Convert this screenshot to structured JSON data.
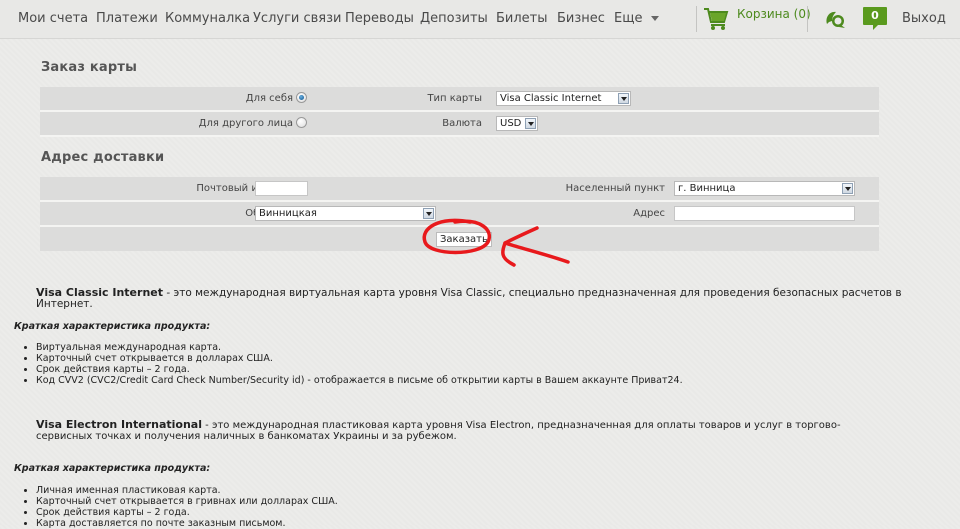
{
  "nav": {
    "items": [
      "Мои счета",
      "Платежи",
      "Коммуналка",
      "Услуги связи",
      "Переводы",
      "Депозиты",
      "Билеты",
      "Бизнес",
      "Еще"
    ],
    "cart_label": "Корзина (0)",
    "messages_count": "0",
    "logout": "Выход",
    "accent_color": "#5a9a1e"
  },
  "order": {
    "title": "Заказ карты",
    "for_self_label": "Для себя",
    "for_other_label": "Для другого лица",
    "recipient_selected": "Для себя",
    "card_type_label": "Тип карты",
    "card_type_value": "Visa Classic Internet",
    "currency_label": "Валюта",
    "currency_value": "USD"
  },
  "delivery": {
    "title": "Адрес доставки",
    "postal_label": "Почтовый индекс",
    "postal_value": "",
    "region_label": "Область",
    "region_value": "Винницкая",
    "city_label": "Населенный пункт",
    "city_value": "г. Винница",
    "address_label": "Адрес",
    "address_value": "",
    "submit_label": "Заказать"
  },
  "products": [
    {
      "name": "Visa Classic Internet",
      "description": " - это международная виртуальная карта уровня Visa Classic, специально предназначенная для проведения безопасных расчетов в Интернет.",
      "features_title": "Краткая характеристика продукта:",
      "features": [
        "Виртуальная международная карта.",
        "Карточный счет открывается в долларах США.",
        "Срок действия карты – 2 года.",
        "Код CVV2 (CVC2/Credit Card Check Number/Security id)  - отображается в письме об открытии карты в Вашем аккаунте Приват24."
      ]
    },
    {
      "name": "Visa Electron International",
      "description": " - это международная пластиковая карта уровня Visa Electron,  предназначенная для оплаты товаров и услуг в торгово-сервисных точках и получения наличных в банкоматах  Украины и за рубежом.",
      "features_title": "Краткая характеристика продукта:",
      "features": [
        "Личная именная пластиковая карта.",
        "Карточный счет открывается в гривнах или долларах США.",
        "Срок действия карты – 2 года.",
        "Карта доставляется по почте заказным письмом."
      ]
    }
  ]
}
